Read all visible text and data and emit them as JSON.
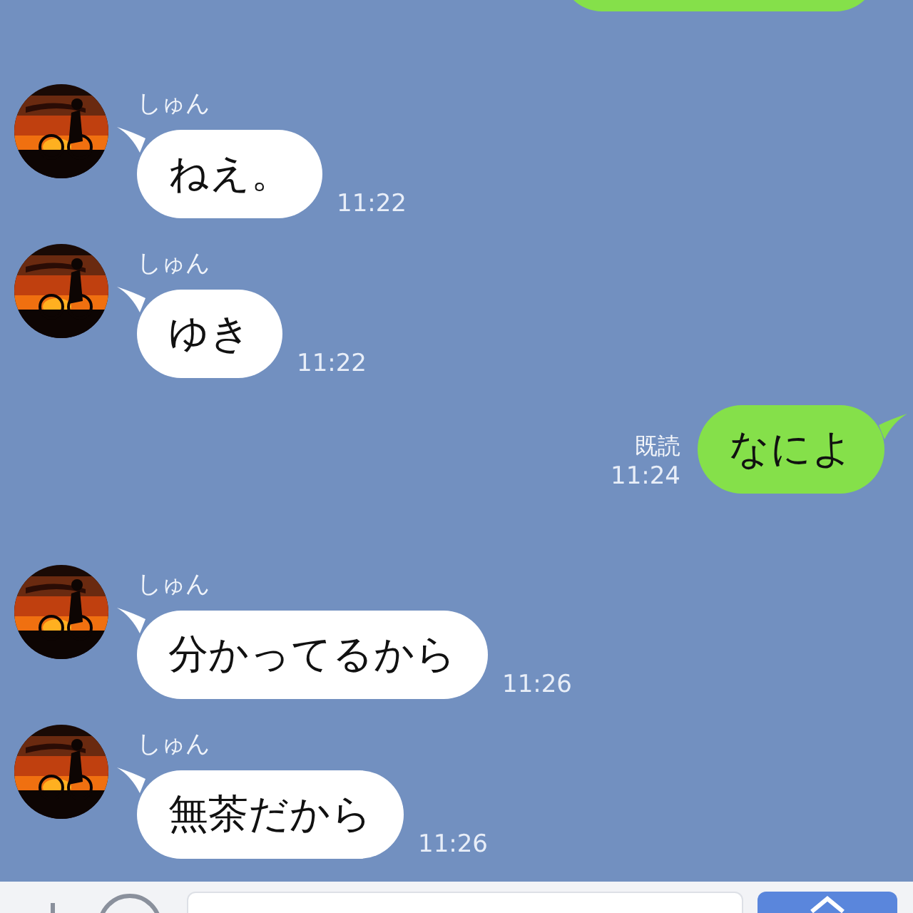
{
  "messages": [
    {
      "kind": "received",
      "sender": "しゅん",
      "text": "ねえ。",
      "time": "11:22"
    },
    {
      "kind": "received",
      "sender": "しゅん",
      "text": "ゆき",
      "time": "11:22"
    },
    {
      "kind": "sent",
      "read_label": "既読",
      "text": "なによ",
      "time": "11:24"
    },
    {
      "kind": "received",
      "sender": "しゅん",
      "text": "分かってるから",
      "time": "11:26"
    },
    {
      "kind": "received",
      "sender": "しゅん",
      "text": "無茶だから",
      "time": "11:26"
    }
  ]
}
